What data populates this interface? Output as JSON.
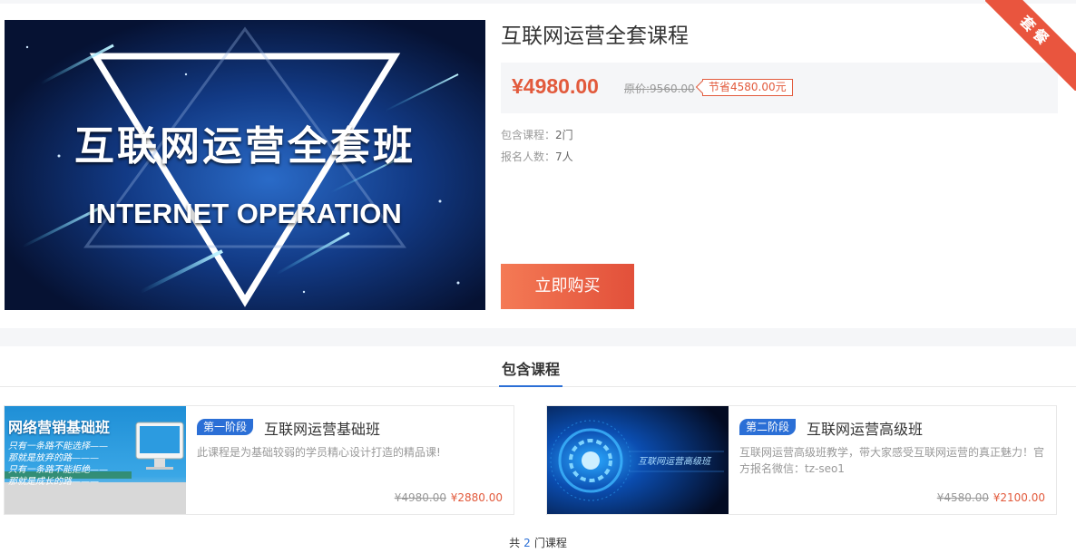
{
  "ribbon": {
    "label": "套餐"
  },
  "banner": {
    "title_cn": "互联网运营全套班",
    "title_en": "INTERNET OPERATION"
  },
  "course": {
    "title": "互联网运营全套课程",
    "price_now": "¥4980.00",
    "price_orig": "原价:9560.00",
    "price_save": "节省4580.00元",
    "included_label": "包含课程：",
    "included_value": "2门",
    "enrolled_label": "报名人数：",
    "enrolled_value": "7人",
    "buy_label": "立即购买"
  },
  "tabs": [
    {
      "label": "包含课程"
    }
  ],
  "cards": [
    {
      "thumb_text": "网络营销基础班",
      "thumb_lines": [
        "只有一条路不能选择——",
        "那就是放弃的路———",
        "只有一条路不能拒绝——",
        "那就是成长的路———"
      ],
      "stage": "第一阶段",
      "name": "互联网运营基础班",
      "desc": "此课程是为基础较弱的学员精心设计打造的精品课!",
      "price_orig": "¥4980.00",
      "price_now": "¥2880.00"
    },
    {
      "thumb_text": "互联网运营高级班",
      "stage": "第二阶段",
      "name": "互联网运营高级班",
      "desc": "互联网运营高级班教学，带大家感受互联网运营的真正魅力！官方报名微信：tz-seo1",
      "price_orig": "¥4580.00",
      "price_now": "¥2100.00"
    }
  ],
  "footer": {
    "prefix": "共",
    "count": "2",
    "suffix": "门课程"
  },
  "colors": {
    "accent": "#e25a3c",
    "blue": "#2b6fd6",
    "gray_bg": "#f5f6f8"
  }
}
